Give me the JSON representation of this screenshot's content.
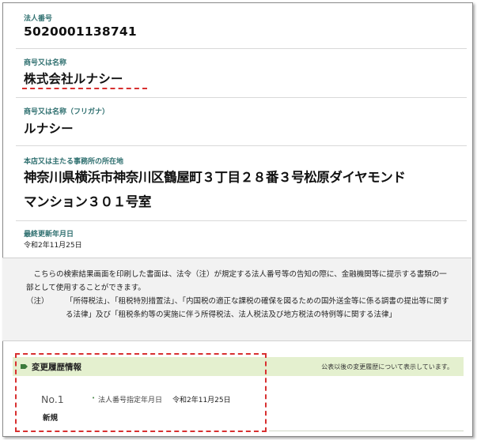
{
  "fields": {
    "corporate_number": {
      "label": "法人番号",
      "value": "5020001138741"
    },
    "name": {
      "label": "商号又は名称",
      "value": "株式会社ルナシー"
    },
    "name_kana": {
      "label": "商号又は名称（フリガナ）",
      "value": "ルナシー"
    },
    "address": {
      "label": "本店又は主たる事務所の所在地",
      "line1": "神奈川県横浜市神奈川区鶴屋町３丁目２８番３号松原ダイヤモンド",
      "line2": "マンション３０１号室"
    },
    "last_updated": {
      "label": "最終更新年月日",
      "value": "令和2年11月25日"
    }
  },
  "notice": {
    "para": "こちらの検索結果画面を印刷した書面は、法令（注）が規定する法人番号等の告知の際に、金融機関等に提示する書類の一部として使用することができます。",
    "note_prefix": "（注）",
    "note": "「所得税法」、「租税特別措置法」、「内国税の適正な課税の確保を図るための国外送金等に係る調書の提出等に関する法律」及び「租税条約等の実施に伴う所得税法、法人税法及び地方税法の特例等に関する法律」"
  },
  "history": {
    "title": "変更履歴情報",
    "note": "公表以後の変更履歴について表示しています。",
    "entries": [
      {
        "no": "No.1",
        "status": "新規",
        "field": "法人番号指定年月日",
        "date": "令和2年11月25日"
      }
    ]
  },
  "colors": {
    "accent_green": "#2e6f6f",
    "history_bar": "#e4f0cf",
    "highlight_red": "#d83030"
  }
}
